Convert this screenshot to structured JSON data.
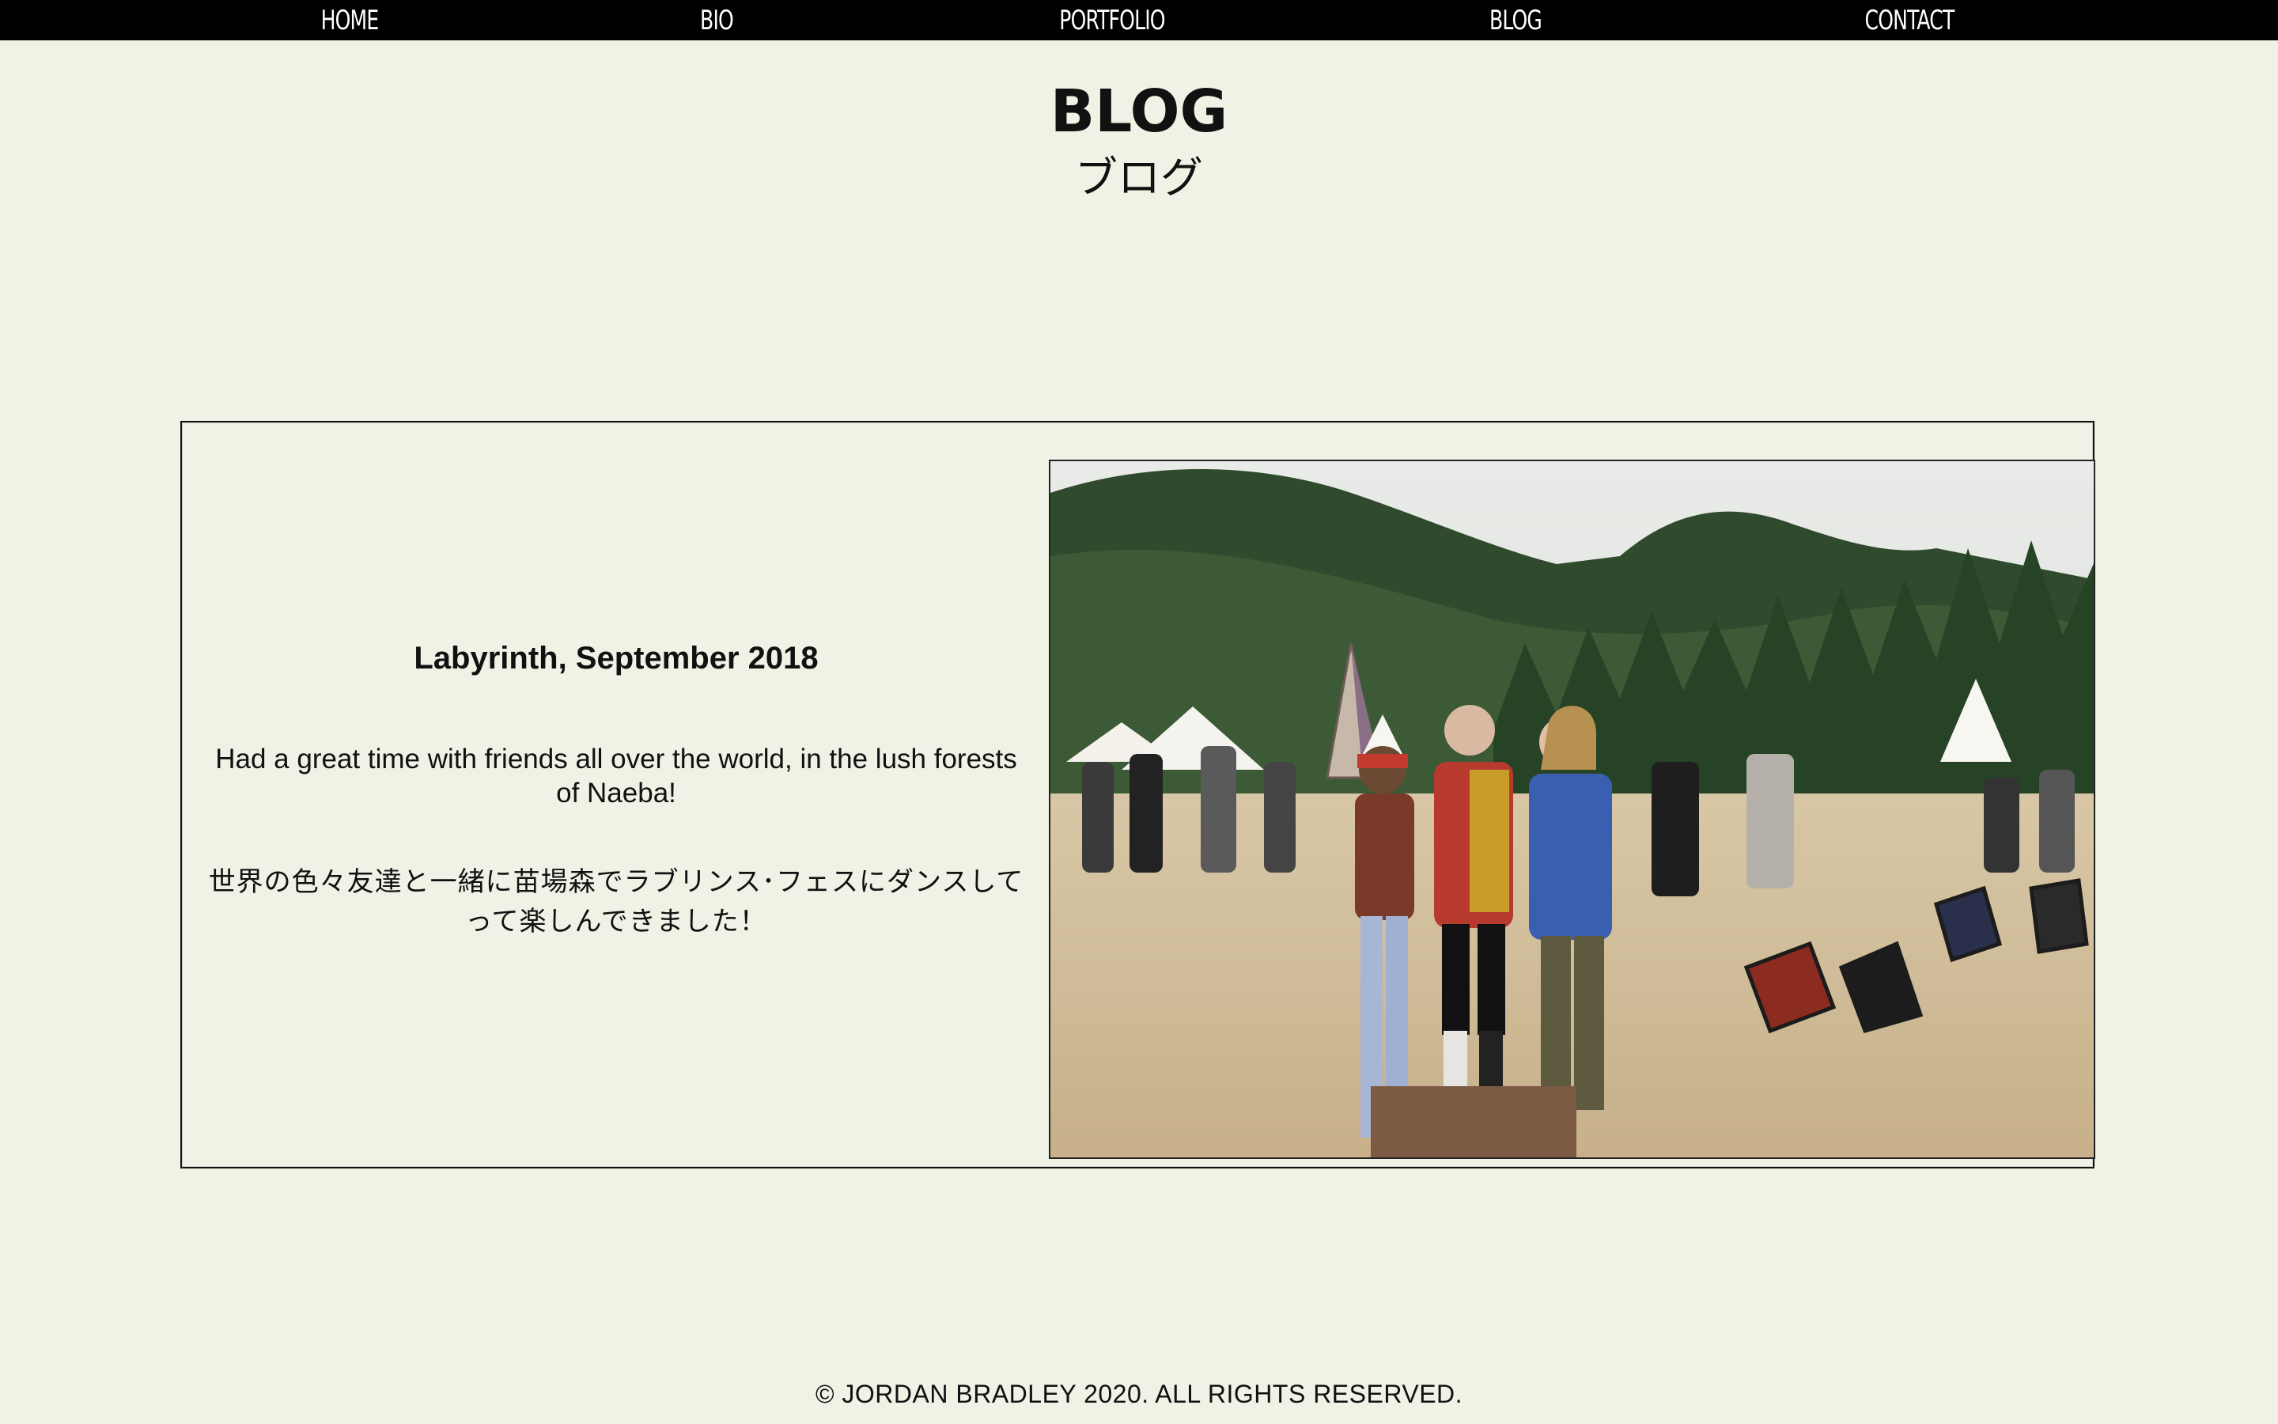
{
  "nav": {
    "items": [
      {
        "label": "HOME"
      },
      {
        "label": "BIO"
      },
      {
        "label": "PORTFOLIO"
      },
      {
        "label": "BLOG"
      },
      {
        "label": "CONTACT"
      }
    ]
  },
  "header": {
    "title": "BLOG",
    "subtitle": "ブログ"
  },
  "post": {
    "title": "Labyrinth, September 2018",
    "body_en": "Had a great time with friends all over the world, in the lush forests of Naeba!",
    "body_ja": "世界の色々友達と一緒に苗場森でラブリンス･フェスにダンスしてって楽しんできました！"
  },
  "footer": {
    "copyright": "© JORDAN BRADLEY 2020. ALL RIGHTS RESERVED."
  }
}
